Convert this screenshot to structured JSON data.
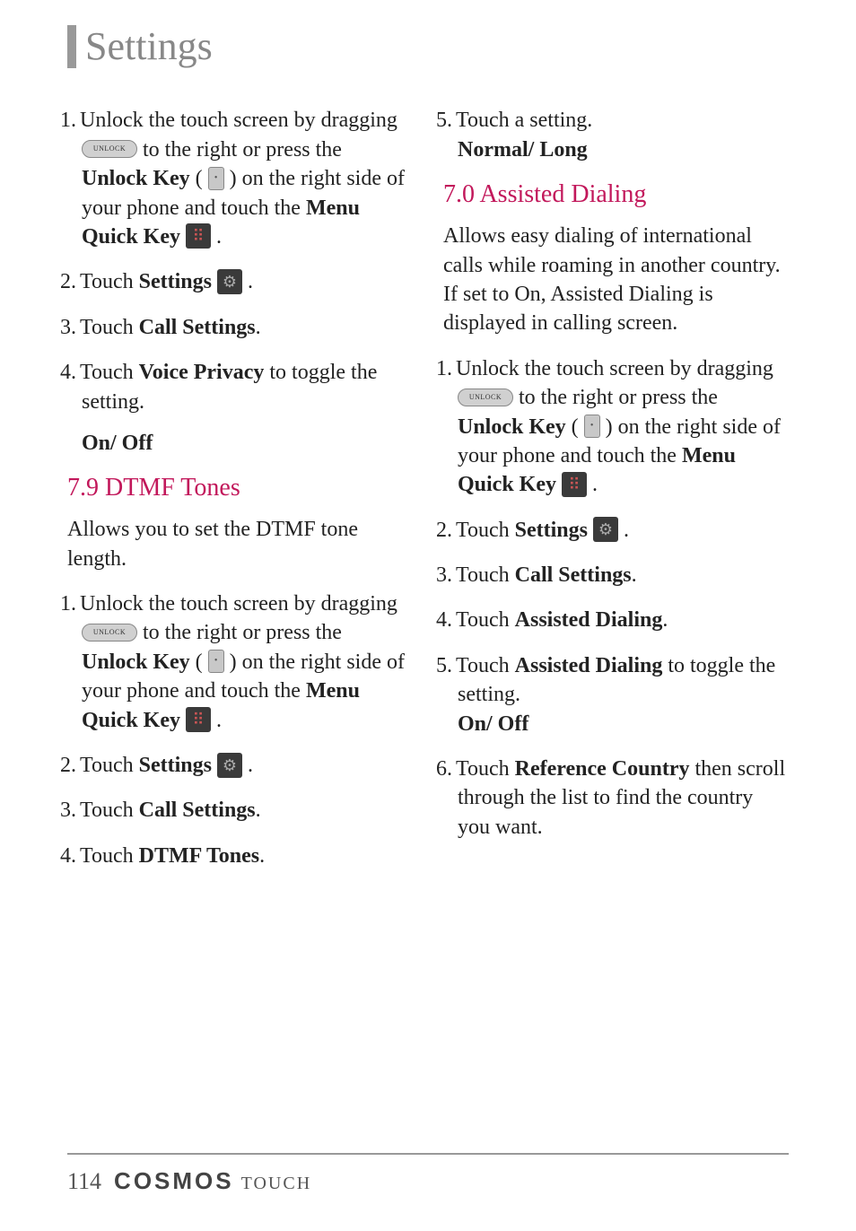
{
  "title": "Settings",
  "col1": {
    "voice_privacy": {
      "s1a": "Unlock the touch screen by dragging ",
      "s1b": " to the right or press the ",
      "s1c": "Unlock Key",
      "s1d": " ( ",
      "s1e": " ) on the right side of your phone and touch the ",
      "s1f": "Menu Quick Key",
      "s1g": " .",
      "s2a": "Touch ",
      "s2b": "Settings",
      "s2c": " .",
      "s3a": "Touch ",
      "s3b": "Call Settings",
      "s3c": ".",
      "s4a": "Touch ",
      "s4b": "Voice Privacy",
      "s4c": " to toggle the setting.",
      "opt": "On/ Off"
    },
    "dtmf": {
      "heading": "7.9 DTMF Tones",
      "desc": "Allows you to set the DTMF tone length.",
      "s1a": "Unlock the touch screen by dragging ",
      "s1b": " to the right or press the ",
      "s1c": "Unlock Key",
      "s1d": " ( ",
      "s1e": " ) on the right side of your phone and touch the ",
      "s1f": "Menu Quick Key",
      "s1g": " .",
      "s2a": "Touch ",
      "s2b": "Settings",
      "s2c": " .",
      "s3a": "Touch ",
      "s3b": "Call Settings",
      "s3c": ".",
      "s4a": "Touch ",
      "s4b": "DTMF Tones",
      "s4c": "."
    }
  },
  "col2": {
    "dtmf": {
      "s5a": "Touch a setting.",
      "opt": "Normal/ Long"
    },
    "ad": {
      "heading": "7.0 Assisted Dialing",
      "desc": "Allows easy dialing of international calls while roaming in another country. If set to On, Assisted Dialing is displayed in calling screen.",
      "s1a": "Unlock the touch screen by dragging ",
      "s1b": " to the right or press the ",
      "s1c": "Unlock Key",
      "s1d": " ( ",
      "s1e": " ) on the right side of your phone and touch the ",
      "s1f": "Menu Quick Key",
      "s1g": " .",
      "s2a": "Touch ",
      "s2b": "Settings",
      "s2c": " .",
      "s3a": "Touch ",
      "s3b": "Call Settings",
      "s3c": ".",
      "s4a": "Touch ",
      "s4b": "Assisted Dialing",
      "s4c": ".",
      "s5a": "Touch ",
      "s5b": "Assisted Dialing",
      "s5c": " to toggle the setting.",
      "opt": "On/ Off",
      "s6a": "Touch ",
      "s6b": "Reference Country",
      "s6c": " then scroll through the list to find the country you want."
    }
  },
  "footer": {
    "page": "114",
    "logo": "COSMOS",
    "suffix": "TOUCH"
  },
  "nums": {
    "n1": "1.",
    "n2": "2.",
    "n3": "3.",
    "n4": "4.",
    "n5": "5.",
    "n6": "6."
  }
}
